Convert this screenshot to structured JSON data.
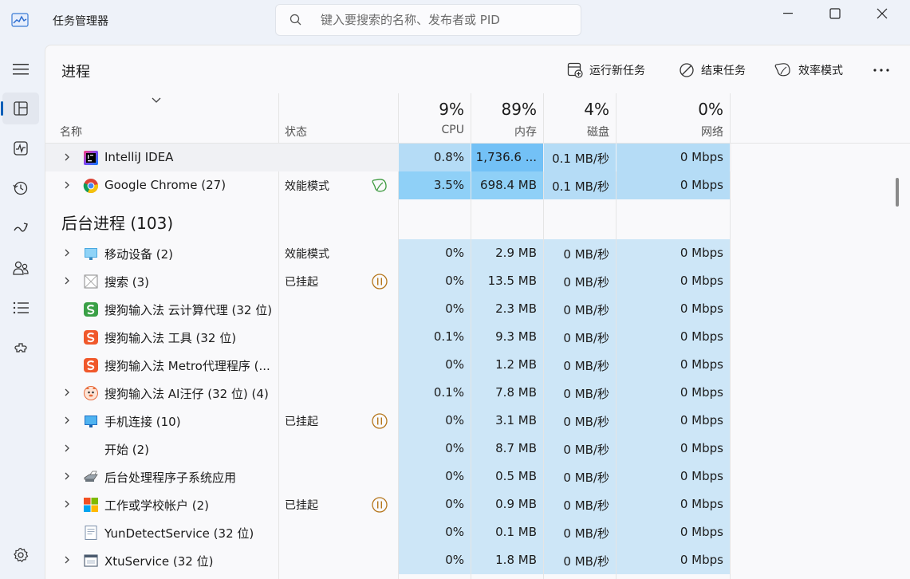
{
  "window": {
    "title": "任务管理器",
    "search_placeholder": "键入要搜索的名称、发布者或 PID"
  },
  "nav": {
    "items": [
      {
        "name": "menu-icon"
      },
      {
        "name": "processes-icon",
        "active": true
      },
      {
        "name": "performance-icon"
      },
      {
        "name": "app-history-icon"
      },
      {
        "name": "startup-apps-icon"
      },
      {
        "name": "users-icon"
      },
      {
        "name": "details-icon"
      },
      {
        "name": "services-icon"
      },
      {
        "name": "settings-icon"
      }
    ]
  },
  "toolbar": {
    "page_title": "进程",
    "run_new_task": "运行新任务",
    "end_task": "结束任务",
    "efficiency_mode": "效率模式",
    "more": "⋯"
  },
  "columns": {
    "name": "名称",
    "status": "状态",
    "cpu_pct": "9%",
    "cpu_label": "CPU",
    "mem_pct": "89%",
    "mem_label": "内存",
    "disk_pct": "4%",
    "disk_label": "磁盘",
    "net_pct": "0%",
    "net_label": "网络"
  },
  "apps": [
    {
      "name": "IntelliJ IDEA",
      "icon": "intellij-icon",
      "status": "",
      "cpu": "0.8%",
      "mem": "1,736.6 ...",
      "disk": "0.1 MB/秒",
      "net": "0 Mbps"
    },
    {
      "name": "Google Chrome (27)",
      "icon": "chrome-icon",
      "status": "效能模式",
      "status_icon": "leaf-icon",
      "cpu": "3.5%",
      "mem": "698.4 MB",
      "disk": "0.1 MB/秒",
      "net": "0 Mbps"
    }
  ],
  "background_group": {
    "title": "后台进程 (103)"
  },
  "background": [
    {
      "name": "移动设备 (2)",
      "icon": "mobile-device-icon",
      "expand": true,
      "status": "效能模式",
      "cpu": "0%",
      "mem": "2.9 MB",
      "disk": "0 MB/秒",
      "net": "0 Mbps"
    },
    {
      "name": "搜索 (3)",
      "icon": "search-app-icon",
      "expand": true,
      "status": "已挂起",
      "status_icon": "paused-icon",
      "cpu": "0%",
      "mem": "13.5 MB",
      "disk": "0 MB/秒",
      "net": "0 Mbps"
    },
    {
      "name": "搜狗输入法 云计算代理 (32 位)",
      "icon": "sogou-cloud-icon",
      "expand": false,
      "status": "",
      "cpu": "0%",
      "mem": "2.3 MB",
      "disk": "0 MB/秒",
      "net": "0 Mbps"
    },
    {
      "name": "搜狗输入法 工具 (32 位)",
      "icon": "sogou-icon",
      "expand": false,
      "status": "",
      "cpu": "0.1%",
      "mem": "9.3 MB",
      "disk": "0 MB/秒",
      "net": "0 Mbps"
    },
    {
      "name": "搜狗输入法 Metro代理程序 (...",
      "icon": "sogou-icon",
      "expand": false,
      "status": "",
      "cpu": "0%",
      "mem": "1.2 MB",
      "disk": "0 MB/秒",
      "net": "0 Mbps"
    },
    {
      "name": "搜狗输入法 AI汪仔 (32 位) (4)",
      "icon": "sogou-ai-icon",
      "expand": true,
      "status": "",
      "cpu": "0.1%",
      "mem": "7.8 MB",
      "disk": "0 MB/秒",
      "net": "0 Mbps"
    },
    {
      "name": "手机连接 (10)",
      "icon": "phone-link-icon",
      "expand": true,
      "status": "已挂起",
      "status_icon": "paused-icon",
      "cpu": "0%",
      "mem": "3.1 MB",
      "disk": "0 MB/秒",
      "net": "0 Mbps"
    },
    {
      "name": "开始 (2)",
      "icon": "",
      "expand": true,
      "status": "",
      "cpu": "0%",
      "mem": "8.7 MB",
      "disk": "0 MB/秒",
      "net": "0 Mbps"
    },
    {
      "name": "后台处理程序子系统应用",
      "icon": "printer-icon",
      "expand": true,
      "status": "",
      "cpu": "0%",
      "mem": "0.5 MB",
      "disk": "0 MB/秒",
      "net": "0 Mbps"
    },
    {
      "name": "工作或学校帐户 (2)",
      "icon": "microsoft-logo-icon",
      "expand": true,
      "status": "已挂起",
      "status_icon": "paused-icon",
      "cpu": "0%",
      "mem": "0.9 MB",
      "disk": "0 MB/秒",
      "net": "0 Mbps"
    },
    {
      "name": "YunDetectService (32 位)",
      "icon": "document-app-icon",
      "expand": false,
      "status": "",
      "cpu": "0%",
      "mem": "0.1 MB",
      "disk": "0 MB/秒",
      "net": "0 Mbps"
    },
    {
      "name": "XtuService (32 位)",
      "icon": "window-app-icon",
      "expand": true,
      "status": "",
      "cpu": "0%",
      "mem": "1.8 MB",
      "disk": "0 MB/秒",
      "net": "0 Mbps"
    }
  ],
  "colors": {
    "accent": "#005fb8",
    "heat_low": "#cde6f7",
    "heat_mid": "#b5dcf6",
    "heat_high": "#8fd0f7",
    "heat_max": "#73c1f6",
    "paused": "#b5761b",
    "leaf": "#3d9a3f"
  }
}
